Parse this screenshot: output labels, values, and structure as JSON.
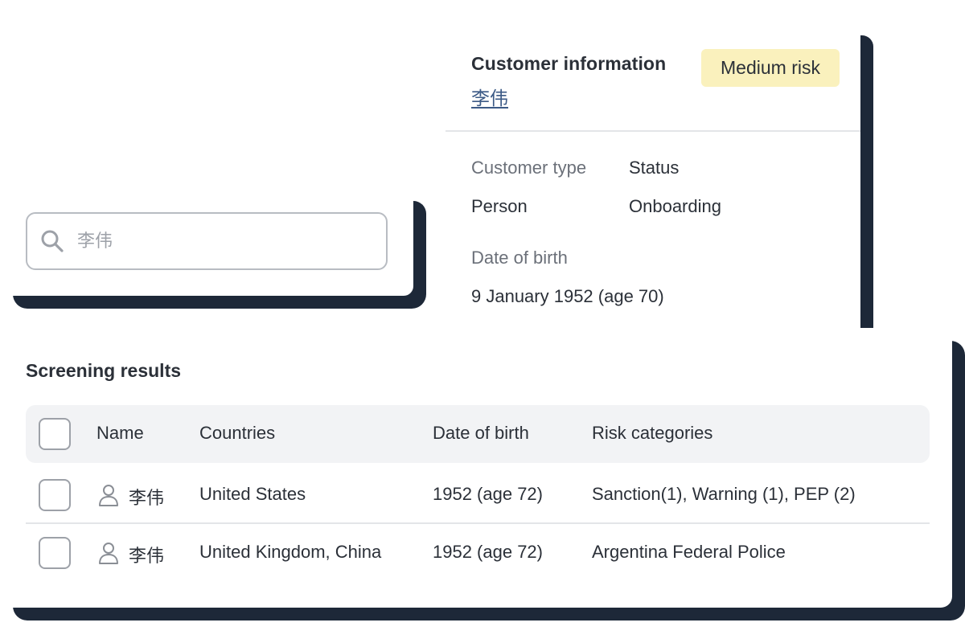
{
  "search": {
    "placeholder": "李伟",
    "icon": "search-icon"
  },
  "customer_info": {
    "title": "Customer information",
    "name": "李伟",
    "risk_badge": "Medium risk",
    "risk_badge_color": "#faf1bd",
    "fields": {
      "customer_type_label": "Customer type",
      "customer_type_value": "Person",
      "status_label": "Status",
      "status_value": "Onboarding",
      "dob_label": "Date of birth",
      "dob_value": "9 January 1952 (age 70)"
    }
  },
  "screening_results": {
    "title": "Screening results",
    "columns": [
      "Name",
      "Countries",
      "Date of birth",
      "Risk categories"
    ],
    "rows": [
      {
        "name": "李伟",
        "icon": "person-icon",
        "countries": "United States",
        "date_of_birth": "1952 (age 72)",
        "risk_categories": "Sanction(1), Warning (1), PEP (2)"
      },
      {
        "name": "李伟",
        "icon": "person-icon",
        "countries": "United Kingdom, China",
        "date_of_birth": "1952 (age 72)",
        "risk_categories": "Argentina Federal Police"
      }
    ]
  },
  "colors": {
    "card_shadow": "#1d2838",
    "link": "#3c5a86",
    "header_row_bg": "#f2f3f5"
  }
}
